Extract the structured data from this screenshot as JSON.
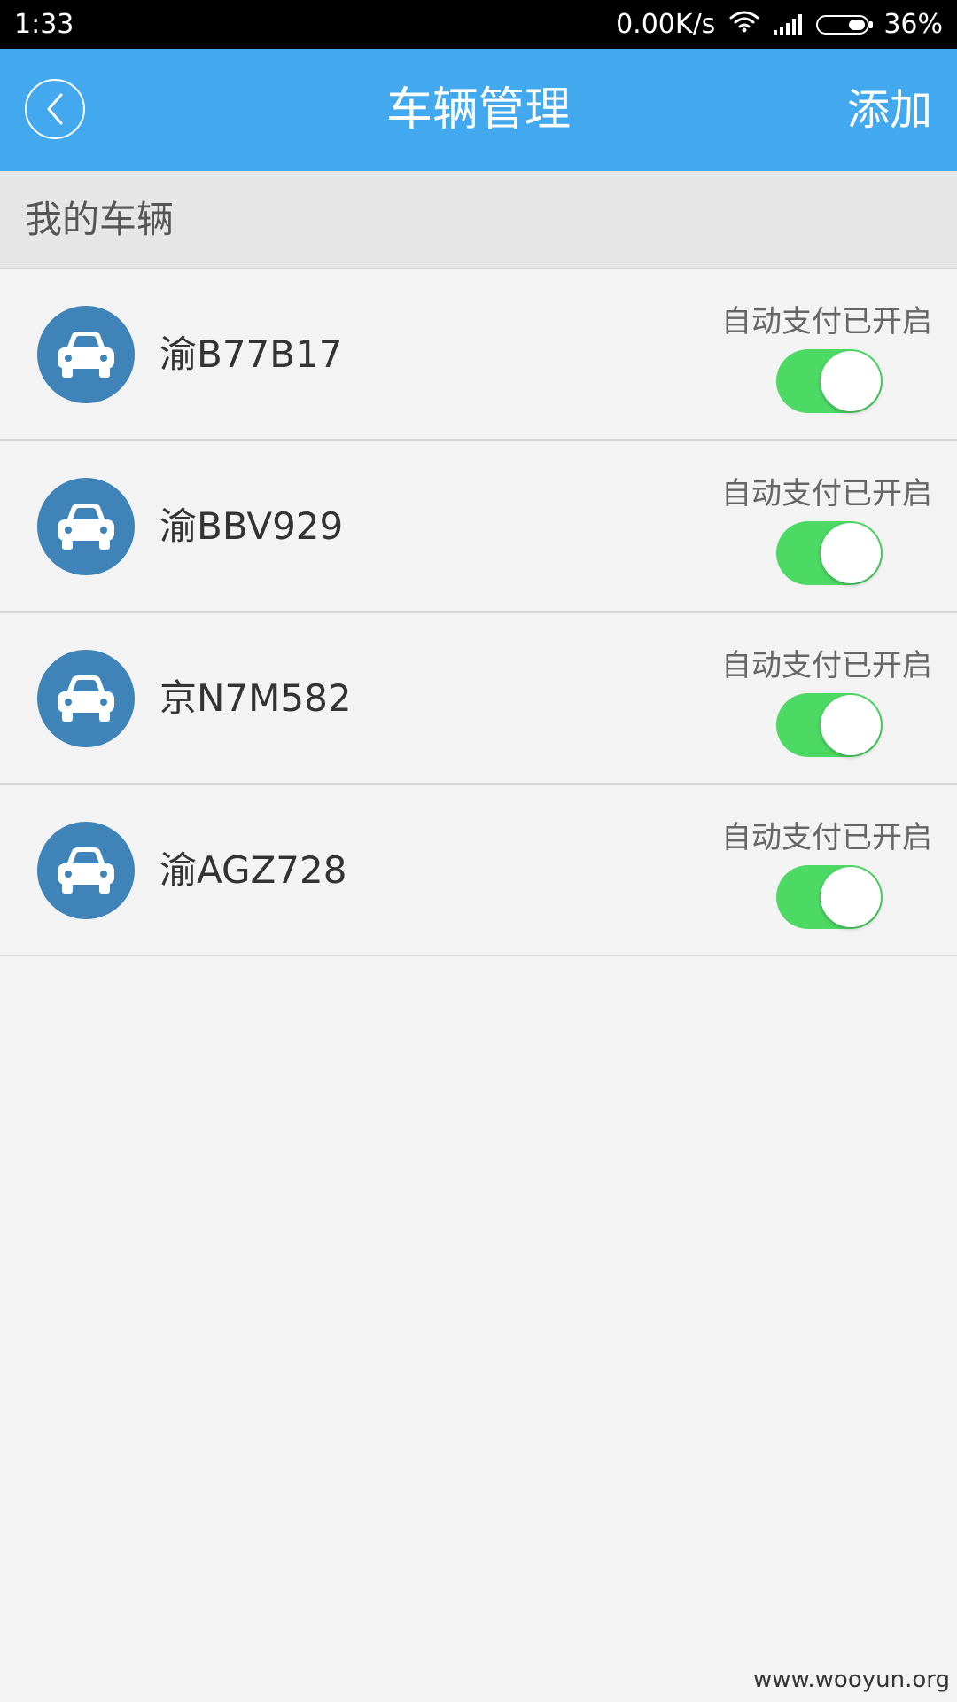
{
  "status_bar": {
    "time": "1:33",
    "net_speed": "0.00K/s",
    "battery": "36%",
    "battery_level": 0.36,
    "wifi_icon": "wifi-icon",
    "signal_icon": "cell-signal-icon"
  },
  "app_bar": {
    "title": "车辆管理",
    "add_label": "添加",
    "back_icon": "chevron-left-icon",
    "color": "#42a9ee"
  },
  "section": {
    "title": "我的车辆"
  },
  "vehicles": [
    {
      "plate": "渝B77B17",
      "status": "自动支付已开启",
      "auto_pay_on": true
    },
    {
      "plate": "渝BBV929",
      "status": "自动支付已开启",
      "auto_pay_on": true
    },
    {
      "plate": "京N7M582",
      "status": "自动支付已开启",
      "auto_pay_on": true
    },
    {
      "plate": "渝AGZ728",
      "status": "自动支付已开启",
      "auto_pay_on": true
    }
  ],
  "colors": {
    "toggle_on": "#4cd964",
    "avatar_bg": "#3f84b8"
  },
  "watermark": "www.wooyun.org"
}
